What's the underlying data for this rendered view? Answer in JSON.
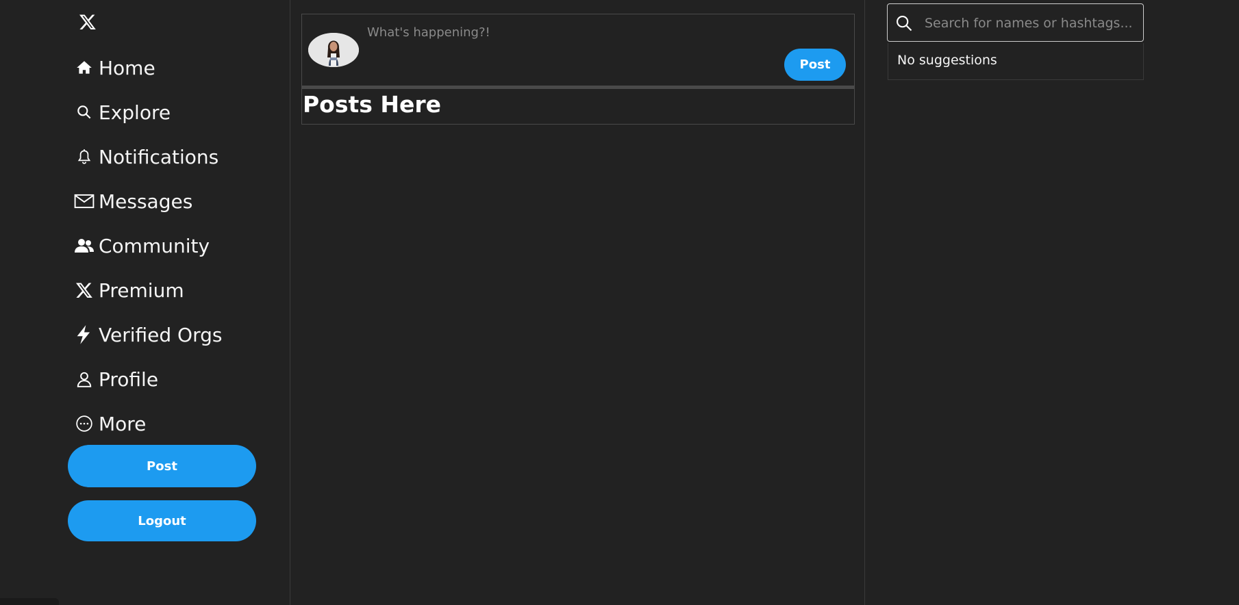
{
  "sidebar": {
    "logo_icon": "x-logo-icon",
    "items": [
      {
        "label": "Home",
        "icon": "home-icon"
      },
      {
        "label": "Explore",
        "icon": "search-icon"
      },
      {
        "label": "Notifications",
        "icon": "bell-icon"
      },
      {
        "label": "Messages",
        "icon": "envelope-icon"
      },
      {
        "label": "Community",
        "icon": "people-icon"
      },
      {
        "label": "Premium",
        "icon": "x-logo-icon"
      },
      {
        "label": "Verified Orgs",
        "icon": "lightning-icon"
      },
      {
        "label": "Profile",
        "icon": "person-icon"
      },
      {
        "label": "More",
        "icon": "more-circle-icon"
      }
    ],
    "post_button": "Post",
    "logout_button": "Logout"
  },
  "composer": {
    "placeholder": "What's happening?!",
    "post_button": "Post"
  },
  "feed": {
    "heading": "Posts Here"
  },
  "search": {
    "placeholder": "Search for names or hashtags...",
    "suggestions_text": "No suggestions"
  },
  "colors": {
    "background": "#222222",
    "accent": "#1d9bf0",
    "border": "#4a4a4a"
  }
}
